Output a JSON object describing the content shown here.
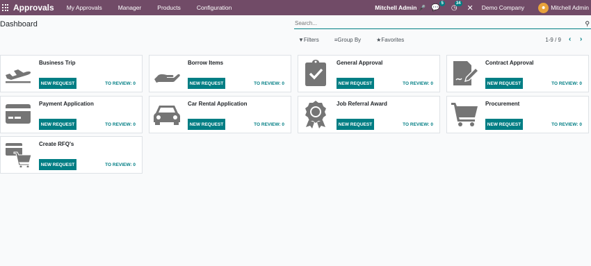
{
  "navbar": {
    "app_name": "Approvals",
    "menu": [
      "My Approvals",
      "Manager",
      "Products",
      "Configuration"
    ],
    "user_status": "Mitchell Admin",
    "messages_count": "5",
    "activities_count": "34",
    "company": "Demo Company",
    "user": "Mitchell Admin"
  },
  "control_panel": {
    "title": "Dashboard",
    "search_placeholder": "Search...",
    "filters": "Filters",
    "group_by": "Group By",
    "favorites": "Favorites",
    "pager": "1-9 / 9"
  },
  "labels": {
    "new_request": "NEW REQUEST",
    "to_review": "TO REVIEW:"
  },
  "cards": [
    {
      "title": "Business Trip",
      "review": "0",
      "icon": "airplane-icon"
    },
    {
      "title": "Borrow Items",
      "review": "0",
      "icon": "hand-icon"
    },
    {
      "title": "General Approval",
      "review": "0",
      "icon": "clipboard-check-icon"
    },
    {
      "title": "Contract Approval",
      "review": "0",
      "icon": "contract-sign-icon"
    },
    {
      "title": "Payment Application",
      "review": "0",
      "icon": "credit-card-icon"
    },
    {
      "title": "Car Rental Application",
      "review": "0",
      "icon": "car-icon"
    },
    {
      "title": "Job Referral Award",
      "review": "0",
      "icon": "award-icon"
    },
    {
      "title": "Procurement",
      "review": "0",
      "icon": "cart-icon"
    },
    {
      "title": "Create RFQ's",
      "review": "0",
      "icon": "card-cart-icon"
    }
  ],
  "colors": {
    "navbar": "#714b67",
    "accent": "#017e84",
    "icon": "#757575"
  }
}
